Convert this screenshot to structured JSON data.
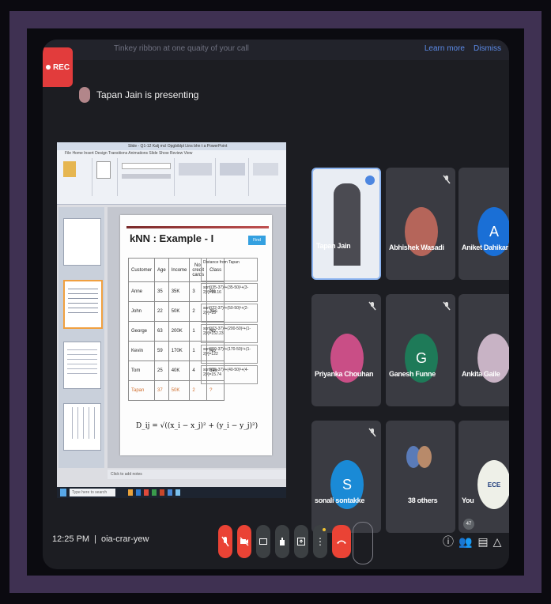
{
  "banner": {
    "message": "Tinkey ribbon at one quaity of your call",
    "learn_more": "Learn more",
    "dismiss": "Dismiss"
  },
  "rec_label": "REC",
  "presenter": {
    "text": "Tapan Jain is presenting"
  },
  "shared_screen": {
    "titlebar": "Slide  -  Q1-12 Kalj mcl Opgbiblpl Ltns bhn t a PowerPoint",
    "menu": "File  Home  Insert  Design  Transitions  Animations  Slide Show  Review  View",
    "slide_title": "kNN : Example - I",
    "find_label": "Find",
    "table": {
      "headers": [
        "Customer",
        "Age",
        "Income",
        "No. credit cards",
        "Class"
      ],
      "rows": [
        [
          "Anne",
          "35",
          "35K",
          "3",
          "No"
        ],
        [
          "John",
          "22",
          "50K",
          "2",
          "Yes"
        ],
        [
          "George",
          "63",
          "200K",
          "1",
          "No"
        ],
        [
          "Kevin",
          "59",
          "170K",
          "1",
          "No"
        ],
        [
          "Tom",
          "25",
          "40K",
          "4",
          "Yes"
        ],
        [
          "Tapan",
          "37",
          "50K",
          "2",
          "?"
        ]
      ],
      "distance_header": "Distance from Tapan",
      "distances": [
        "sqrt[(35-37)²+(35-50)²+(3-2)²]=15.16",
        "sqrt[(22-37)²+(50-50)²+(2-2)²]=15",
        "sqrt[(63-37)²+(200-50)²+(1-2)²]=152.23",
        "sqrt[(59-37)²+(170-50)²+(1-2)²]=122",
        "sqrt[(25-37)²+(40-50)²+(4-2)²]=15.74"
      ]
    },
    "formula": "D_ij = √((x_i − x_j)² + (y_i − y_j)²)",
    "notes_placeholder": "Click to add notes",
    "taskbar_search": "Type here to search"
  },
  "participants": [
    {
      "name": "Tapan Jain",
      "initial": "",
      "color": "#c6cbd3",
      "active": true
    },
    {
      "name": "Abhishek Wasadi",
      "initial": "",
      "color": "#b5655a",
      "active": false
    },
    {
      "name": "Aniket Dahikar",
      "initial": "A",
      "color": "#1a6fd6",
      "active": false
    },
    {
      "name": "Priyanka Chouhan",
      "initial": "",
      "color": "#c94e86",
      "active": false
    },
    {
      "name": "Ganesh Funne",
      "initial": "G",
      "color": "#1e7a58",
      "active": false
    },
    {
      "name": "Ankita Gaile",
      "initial": "",
      "color": "#c8b3c5",
      "active": false
    },
    {
      "name": "sonali sontakke",
      "initial": "S",
      "color": "#1a8ad6",
      "active": false
    },
    {
      "name": "38 others",
      "initial": "",
      "color": "#5a7bb8",
      "active": false
    },
    {
      "name": "You",
      "initial": "ECE",
      "color": "#eef0e8",
      "active": false
    }
  ],
  "footer": {
    "time": "12:25 PM",
    "separator": "|",
    "meeting_code": "oia-crar-yew"
  },
  "people_badge": "47",
  "colors": {
    "accent_red": "#e23c3c",
    "control_red": "#ea4335",
    "frame": "#3f3152"
  }
}
